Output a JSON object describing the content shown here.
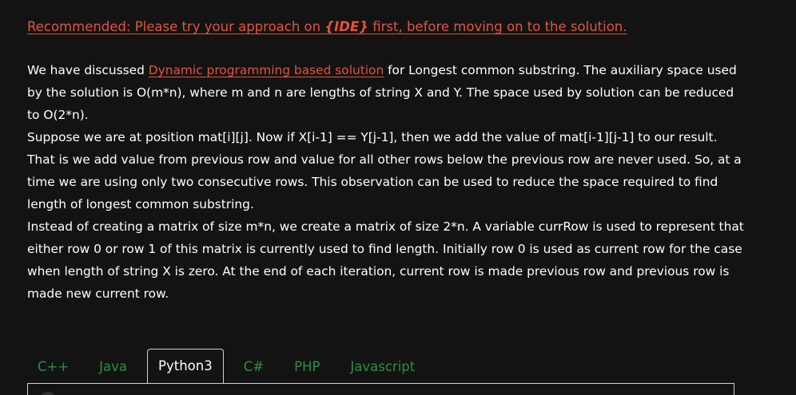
{
  "recommendation": {
    "prefix": "Recommended: Please try your approach on ",
    "ide": "{IDE}",
    "suffix": " first, before moving on to the solution."
  },
  "paragraphs": {
    "p1_before": "We have discussed ",
    "p1_link": "Dynamic programming based solution",
    "p1_after": " for Longest common substring. The auxiliary space used by the solution is O(m*n), where m and n are lengths of string X and Y. The space used by solution can be reduced to O(2*n).",
    "p2": "Suppose we are at position mat[i][j]. Now if X[i-1] == Y[j-1], then we add the value of mat[i-1][j-1] to our result. That is we add value from previous row and value for all other rows below the previous row are never used. So, at a time we are using only two consecutive rows. This observation can be used to reduce the space required to find length of longest common substring.",
    "p3": "Instead of creating a matrix of size m*n, we create a matrix of size 2*n. A variable currRow is used to represent that either row 0 or row 1 of this matrix is currently used to find length. Initially row 0 is used as current row for the case when length of string X is zero. At the end of each iteration, current row is made previous row and previous row is made new current row."
  },
  "tabs": [
    {
      "label": "C++"
    },
    {
      "label": "Java"
    },
    {
      "label": "Python3"
    },
    {
      "label": "C#"
    },
    {
      "label": "PHP"
    },
    {
      "label": "Javascript"
    }
  ],
  "active_tab": "Python3",
  "colors": {
    "background": "#131313",
    "link": "#e2543c",
    "tab_inactive": "#2f8d46",
    "text": "#ffffff"
  }
}
